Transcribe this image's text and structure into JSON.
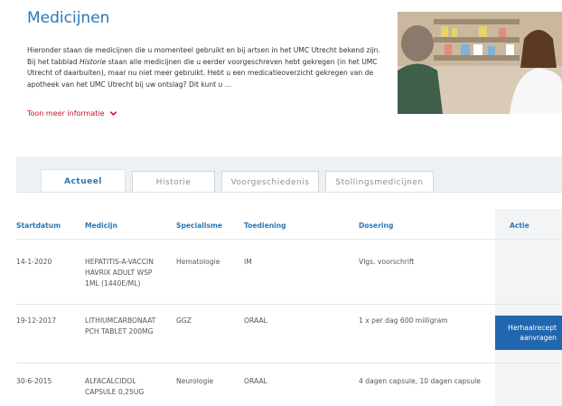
{
  "intro": {
    "title": "Medicijnen",
    "text_part1": "Hieronder staan de medicijnen die u momenteel gebruikt en bij artsen in het UMC Utrecht bekend zijn. Bij het tabblad ",
    "text_em": "Historie",
    "text_part2": " staan alle medicijnen die u eerder voorgeschreven hebt gekregen (in het UMC Utrecht of daarbuiten), maar nu niet meer gebruikt. Hebt u een medicatieoverzicht gekregen van de apotheek van het UMC Utrecht bij uw ontslag? Dit kunt u …",
    "more_label": "Toon meer informatie",
    "more_icon": "chevron-down-icon",
    "photo_icon": "pharmacy-photo"
  },
  "tabs": [
    {
      "label": "Actueel",
      "active": true
    },
    {
      "label": "Historie",
      "active": false
    },
    {
      "label": "Voorgeschiedenis",
      "active": false
    },
    {
      "label": "Stollingsmedicijnen",
      "active": false
    }
  ],
  "table": {
    "headers": {
      "start": "Startdatum",
      "medicine": "Medicijn",
      "specialism": "Specialisme",
      "admin": "Toediening",
      "dosage": "Dosering",
      "action": "Actie"
    },
    "rows": [
      {
        "start": "14-1-2020",
        "medicine": "HEPATITIS-A-VACCIN HAVRIX ADULT WSP 1ML (1440E/ML)",
        "specialism": "Hematologie",
        "admin": "IM",
        "dosage": "Vlgs. voorschrift",
        "action": ""
      },
      {
        "start": "19-12-2017",
        "medicine": "LITHIUMCARBONAAT PCH TABLET 200MG",
        "specialism": "GGZ",
        "admin": "ORAAL",
        "dosage": "1 x per dag 600 milligram",
        "action": "Herhaalrecept aanvragen"
      },
      {
        "start": "30-6-2015",
        "medicine": "ALFACALCIDOL CAPSULE 0,25UG",
        "specialism": "Neurologie",
        "admin": "ORAAL",
        "dosage": "4 dagen  capsule, 10 dagen  capsule",
        "action": ""
      }
    ]
  },
  "colors": {
    "brand_blue": "#2a78b8",
    "button_blue": "#2167b0",
    "link_red": "#c8102e",
    "tabbar_bg": "#eef1f4"
  }
}
